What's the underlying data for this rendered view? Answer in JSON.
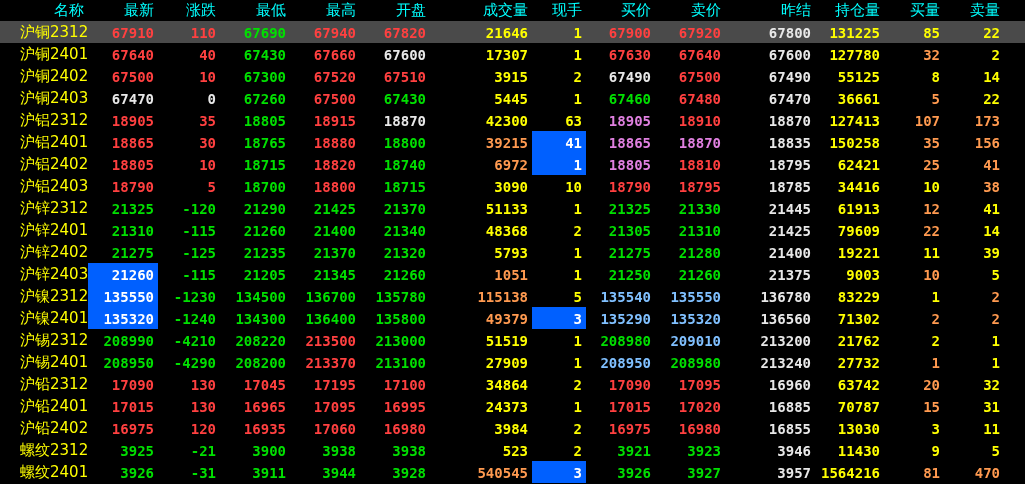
{
  "columns": [
    "名称",
    "最新",
    "涨跌",
    "最低",
    "最高",
    "开盘",
    "成交量",
    "现手",
    "买价",
    "卖价",
    "昨结",
    "持仓量",
    "买量",
    "卖量"
  ],
  "rows": [
    {
      "name": "沪铜2312",
      "selected": true,
      "cells": [
        {
          "text": "67910",
          "color": "#ff4040",
          "highlighted": false
        },
        {
          "text": "110",
          "color": "#ff4040",
          "highlighted": false
        },
        {
          "text": "67690",
          "color": "#00e000",
          "highlighted": false
        },
        {
          "text": "67940",
          "color": "#ff4040",
          "highlighted": false
        },
        {
          "text": "67820",
          "color": "#ff4040",
          "highlighted": false
        },
        {
          "text": "21646",
          "color": "#ffff00",
          "highlighted": false
        },
        {
          "text": "1",
          "color": "#ffff00",
          "highlighted": false
        },
        {
          "text": "67900",
          "color": "#ff4040",
          "highlighted": false
        },
        {
          "text": "67920",
          "color": "#ff4040",
          "highlighted": false
        },
        {
          "text": "67800",
          "color": "#e8e8e8",
          "highlighted": false
        },
        {
          "text": "131225",
          "color": "#ffff00",
          "highlighted": false
        },
        {
          "text": "85",
          "color": "#ffff00",
          "highlighted": false
        },
        {
          "text": "22",
          "color": "#ffff00",
          "highlighted": false
        }
      ]
    },
    {
      "name": "沪铜2401",
      "selected": false,
      "cells": [
        {
          "text": "67640",
          "color": "#ff4040",
          "highlighted": false
        },
        {
          "text": "40",
          "color": "#ff4040",
          "highlighted": false
        },
        {
          "text": "67430",
          "color": "#00e000",
          "highlighted": false
        },
        {
          "text": "67660",
          "color": "#ff4040",
          "highlighted": false
        },
        {
          "text": "67600",
          "color": "#e8e8e8",
          "highlighted": false
        },
        {
          "text": "17307",
          "color": "#ffff00",
          "highlighted": false
        },
        {
          "text": "1",
          "color": "#ffff00",
          "highlighted": false
        },
        {
          "text": "67630",
          "color": "#ff4040",
          "highlighted": false
        },
        {
          "text": "67640",
          "color": "#ff4040",
          "highlighted": false
        },
        {
          "text": "67600",
          "color": "#e8e8e8",
          "highlighted": false
        },
        {
          "text": "127780",
          "color": "#ffff00",
          "highlighted": false
        },
        {
          "text": "32",
          "color": "#ff9a50",
          "highlighted": false
        },
        {
          "text": "2",
          "color": "#ffff00",
          "highlighted": false
        }
      ]
    },
    {
      "name": "沪铜2402",
      "selected": false,
      "cells": [
        {
          "text": "67500",
          "color": "#ff4040",
          "highlighted": false
        },
        {
          "text": "10",
          "color": "#ff4040",
          "highlighted": false
        },
        {
          "text": "67300",
          "color": "#00e000",
          "highlighted": false
        },
        {
          "text": "67520",
          "color": "#ff4040",
          "highlighted": false
        },
        {
          "text": "67510",
          "color": "#ff4040",
          "highlighted": false
        },
        {
          "text": "3915",
          "color": "#ffff00",
          "highlighted": false
        },
        {
          "text": "2",
          "color": "#ffff00",
          "highlighted": false
        },
        {
          "text": "67490",
          "color": "#e8e8e8",
          "highlighted": false
        },
        {
          "text": "67500",
          "color": "#ff4040",
          "highlighted": false
        },
        {
          "text": "67490",
          "color": "#e8e8e8",
          "highlighted": false
        },
        {
          "text": "55125",
          "color": "#ffff00",
          "highlighted": false
        },
        {
          "text": "8",
          "color": "#ffff00",
          "highlighted": false
        },
        {
          "text": "14",
          "color": "#ffff00",
          "highlighted": false
        }
      ]
    },
    {
      "name": "沪铜2403",
      "selected": false,
      "cells": [
        {
          "text": "67470",
          "color": "#e8e8e8",
          "highlighted": false
        },
        {
          "text": "0",
          "color": "#e8e8e8",
          "highlighted": false
        },
        {
          "text": "67260",
          "color": "#00e000",
          "highlighted": false
        },
        {
          "text": "67500",
          "color": "#ff4040",
          "highlighted": false
        },
        {
          "text": "67430",
          "color": "#00e000",
          "highlighted": false
        },
        {
          "text": "5445",
          "color": "#ffff00",
          "highlighted": false
        },
        {
          "text": "1",
          "color": "#ffff00",
          "highlighted": false
        },
        {
          "text": "67460",
          "color": "#00e000",
          "highlighted": false
        },
        {
          "text": "67480",
          "color": "#ff4040",
          "highlighted": false
        },
        {
          "text": "67470",
          "color": "#e8e8e8",
          "highlighted": false
        },
        {
          "text": "36661",
          "color": "#ffff00",
          "highlighted": false
        },
        {
          "text": "5",
          "color": "#ff9a50",
          "highlighted": false
        },
        {
          "text": "22",
          "color": "#ffff00",
          "highlighted": false
        }
      ]
    },
    {
      "name": "沪铝2312",
      "selected": false,
      "cells": [
        {
          "text": "18905",
          "color": "#ff4040",
          "highlighted": false
        },
        {
          "text": "35",
          "color": "#ff4040",
          "highlighted": false
        },
        {
          "text": "18805",
          "color": "#00e000",
          "highlighted": false
        },
        {
          "text": "18915",
          "color": "#ff4040",
          "highlighted": false
        },
        {
          "text": "18870",
          "color": "#e8e8e8",
          "highlighted": false
        },
        {
          "text": "42300",
          "color": "#ffff00",
          "highlighted": false
        },
        {
          "text": "63",
          "color": "#ffff00",
          "highlighted": false
        },
        {
          "text": "18905",
          "color": "#e080e0",
          "highlighted": false
        },
        {
          "text": "18910",
          "color": "#ff4040",
          "highlighted": false
        },
        {
          "text": "18870",
          "color": "#e8e8e8",
          "highlighted": false
        },
        {
          "text": "127413",
          "color": "#ffff00",
          "highlighted": false
        },
        {
          "text": "107",
          "color": "#ff9a50",
          "highlighted": false
        },
        {
          "text": "173",
          "color": "#ff9a50",
          "highlighted": false
        }
      ]
    },
    {
      "name": "沪铝2401",
      "selected": false,
      "cells": [
        {
          "text": "18865",
          "color": "#ff4040",
          "highlighted": false
        },
        {
          "text": "30",
          "color": "#ff4040",
          "highlighted": false
        },
        {
          "text": "18765",
          "color": "#00e000",
          "highlighted": false
        },
        {
          "text": "18880",
          "color": "#ff4040",
          "highlighted": false
        },
        {
          "text": "18800",
          "color": "#00e000",
          "highlighted": false
        },
        {
          "text": "39215",
          "color": "#ff9a50",
          "highlighted": false
        },
        {
          "text": "41",
          "color": "#ffffff",
          "highlighted": true
        },
        {
          "text": "18865",
          "color": "#e080e0",
          "highlighted": false
        },
        {
          "text": "18870",
          "color": "#e080e0",
          "highlighted": false
        },
        {
          "text": "18835",
          "color": "#e8e8e8",
          "highlighted": false
        },
        {
          "text": "150258",
          "color": "#ffff00",
          "highlighted": false
        },
        {
          "text": "35",
          "color": "#ff9a50",
          "highlighted": false
        },
        {
          "text": "156",
          "color": "#ff9a50",
          "highlighted": false
        }
      ]
    },
    {
      "name": "沪铝2402",
      "selected": false,
      "cells": [
        {
          "text": "18805",
          "color": "#ff4040",
          "highlighted": false
        },
        {
          "text": "10",
          "color": "#ff4040",
          "highlighted": false
        },
        {
          "text": "18715",
          "color": "#00e000",
          "highlighted": false
        },
        {
          "text": "18820",
          "color": "#ff4040",
          "highlighted": false
        },
        {
          "text": "18740",
          "color": "#00e000",
          "highlighted": false
        },
        {
          "text": "6972",
          "color": "#ff9a50",
          "highlighted": false
        },
        {
          "text": "1",
          "color": "#ffffff",
          "highlighted": true
        },
        {
          "text": "18805",
          "color": "#e080e0",
          "highlighted": false
        },
        {
          "text": "18810",
          "color": "#ff4040",
          "highlighted": false
        },
        {
          "text": "18795",
          "color": "#e8e8e8",
          "highlighted": false
        },
        {
          "text": "62421",
          "color": "#ffff00",
          "highlighted": false
        },
        {
          "text": "25",
          "color": "#ff9a50",
          "highlighted": false
        },
        {
          "text": "41",
          "color": "#ff9a50",
          "highlighted": false
        }
      ]
    },
    {
      "name": "沪铝2403",
      "selected": false,
      "cells": [
        {
          "text": "18790",
          "color": "#ff4040",
          "highlighted": false
        },
        {
          "text": "5",
          "color": "#ff4040",
          "highlighted": false
        },
        {
          "text": "18700",
          "color": "#00e000",
          "highlighted": false
        },
        {
          "text": "18800",
          "color": "#ff4040",
          "highlighted": false
        },
        {
          "text": "18715",
          "color": "#00e000",
          "highlighted": false
        },
        {
          "text": "3090",
          "color": "#ffff00",
          "highlighted": false
        },
        {
          "text": "10",
          "color": "#ffff00",
          "highlighted": false
        },
        {
          "text": "18790",
          "color": "#ff4040",
          "highlighted": false
        },
        {
          "text": "18795",
          "color": "#ff4040",
          "highlighted": false
        },
        {
          "text": "18785",
          "color": "#e8e8e8",
          "highlighted": false
        },
        {
          "text": "34416",
          "color": "#ffff00",
          "highlighted": false
        },
        {
          "text": "10",
          "color": "#ffff00",
          "highlighted": false
        },
        {
          "text": "38",
          "color": "#ff9a50",
          "highlighted": false
        }
      ]
    },
    {
      "name": "沪锌2312",
      "selected": false,
      "cells": [
        {
          "text": "21325",
          "color": "#00e000",
          "highlighted": false
        },
        {
          "text": "-120",
          "color": "#00e000",
          "highlighted": false
        },
        {
          "text": "21290",
          "color": "#00e000",
          "highlighted": false
        },
        {
          "text": "21425",
          "color": "#00e000",
          "highlighted": false
        },
        {
          "text": "21370",
          "color": "#00e000",
          "highlighted": false
        },
        {
          "text": "51133",
          "color": "#ffff00",
          "highlighted": false
        },
        {
          "text": "1",
          "color": "#ffff00",
          "highlighted": false
        },
        {
          "text": "21325",
          "color": "#00e000",
          "highlighted": false
        },
        {
          "text": "21330",
          "color": "#00e000",
          "highlighted": false
        },
        {
          "text": "21445",
          "color": "#e8e8e8",
          "highlighted": false
        },
        {
          "text": "61913",
          "color": "#ffff00",
          "highlighted": false
        },
        {
          "text": "12",
          "color": "#ff9a50",
          "highlighted": false
        },
        {
          "text": "41",
          "color": "#ffff00",
          "highlighted": false
        }
      ]
    },
    {
      "name": "沪锌2401",
      "selected": false,
      "cells": [
        {
          "text": "21310",
          "color": "#00e000",
          "highlighted": false
        },
        {
          "text": "-115",
          "color": "#00e000",
          "highlighted": false
        },
        {
          "text": "21260",
          "color": "#00e000",
          "highlighted": false
        },
        {
          "text": "21400",
          "color": "#00e000",
          "highlighted": false
        },
        {
          "text": "21340",
          "color": "#00e000",
          "highlighted": false
        },
        {
          "text": "48368",
          "color": "#ffff00",
          "highlighted": false
        },
        {
          "text": "2",
          "color": "#ffff00",
          "highlighted": false
        },
        {
          "text": "21305",
          "color": "#00e000",
          "highlighted": false
        },
        {
          "text": "21310",
          "color": "#00e000",
          "highlighted": false
        },
        {
          "text": "21425",
          "color": "#e8e8e8",
          "highlighted": false
        },
        {
          "text": "79609",
          "color": "#ffff00",
          "highlighted": false
        },
        {
          "text": "22",
          "color": "#ff9a50",
          "highlighted": false
        },
        {
          "text": "14",
          "color": "#ffff00",
          "highlighted": false
        }
      ]
    },
    {
      "name": "沪锌2402",
      "selected": false,
      "cells": [
        {
          "text": "21275",
          "color": "#00e000",
          "highlighted": false
        },
        {
          "text": "-125",
          "color": "#00e000",
          "highlighted": false
        },
        {
          "text": "21235",
          "color": "#00e000",
          "highlighted": false
        },
        {
          "text": "21370",
          "color": "#00e000",
          "highlighted": false
        },
        {
          "text": "21320",
          "color": "#00e000",
          "highlighted": false
        },
        {
          "text": "5793",
          "color": "#ffff00",
          "highlighted": false
        },
        {
          "text": "1",
          "color": "#ffff00",
          "highlighted": false
        },
        {
          "text": "21275",
          "color": "#00e000",
          "highlighted": false
        },
        {
          "text": "21280",
          "color": "#00e000",
          "highlighted": false
        },
        {
          "text": "21400",
          "color": "#e8e8e8",
          "highlighted": false
        },
        {
          "text": "19221",
          "color": "#ffff00",
          "highlighted": false
        },
        {
          "text": "11",
          "color": "#ffff00",
          "highlighted": false
        },
        {
          "text": "39",
          "color": "#ffff00",
          "highlighted": false
        }
      ]
    },
    {
      "name": "沪锌2403",
      "selected": false,
      "cells": [
        {
          "text": "21260",
          "color": "#ffffff",
          "highlighted": true
        },
        {
          "text": "-115",
          "color": "#00e000",
          "highlighted": false
        },
        {
          "text": "21205",
          "color": "#00e000",
          "highlighted": false
        },
        {
          "text": "21345",
          "color": "#00e000",
          "highlighted": false
        },
        {
          "text": "21260",
          "color": "#00e000",
          "highlighted": false
        },
        {
          "text": "1051",
          "color": "#ff9a50",
          "highlighted": false
        },
        {
          "text": "1",
          "color": "#ffff00",
          "highlighted": false
        },
        {
          "text": "21250",
          "color": "#00e000",
          "highlighted": false
        },
        {
          "text": "21260",
          "color": "#00e000",
          "highlighted": false
        },
        {
          "text": "21375",
          "color": "#e8e8e8",
          "highlighted": false
        },
        {
          "text": "9003",
          "color": "#ffff00",
          "highlighted": false
        },
        {
          "text": "10",
          "color": "#ff9a50",
          "highlighted": false
        },
        {
          "text": "5",
          "color": "#ffff00",
          "highlighted": false
        }
      ]
    },
    {
      "name": "沪镍2312",
      "selected": false,
      "cells": [
        {
          "text": "135550",
          "color": "#ffffff",
          "highlighted": true
        },
        {
          "text": "-1230",
          "color": "#00e000",
          "highlighted": false
        },
        {
          "text": "134500",
          "color": "#00e000",
          "highlighted": false
        },
        {
          "text": "136700",
          "color": "#00e000",
          "highlighted": false
        },
        {
          "text": "135780",
          "color": "#00e000",
          "highlighted": false
        },
        {
          "text": "115138",
          "color": "#ff9a50",
          "highlighted": false
        },
        {
          "text": "5",
          "color": "#ffff00",
          "highlighted": false
        },
        {
          "text": "135540",
          "color": "#80c0ff",
          "highlighted": false
        },
        {
          "text": "135550",
          "color": "#80c0ff",
          "highlighted": false
        },
        {
          "text": "136780",
          "color": "#e8e8e8",
          "highlighted": false
        },
        {
          "text": "83229",
          "color": "#ffff00",
          "highlighted": false
        },
        {
          "text": "1",
          "color": "#ffff00",
          "highlighted": false
        },
        {
          "text": "2",
          "color": "#ff9a50",
          "highlighted": false
        }
      ]
    },
    {
      "name": "沪镍2401",
      "selected": false,
      "cells": [
        {
          "text": "135320",
          "color": "#ffffff",
          "highlighted": true
        },
        {
          "text": "-1240",
          "color": "#00e000",
          "highlighted": false
        },
        {
          "text": "134300",
          "color": "#00e000",
          "highlighted": false
        },
        {
          "text": "136400",
          "color": "#00e000",
          "highlighted": false
        },
        {
          "text": "135800",
          "color": "#00e000",
          "highlighted": false
        },
        {
          "text": "49379",
          "color": "#ff9a50",
          "highlighted": false
        },
        {
          "text": "3",
          "color": "#ffffff",
          "highlighted": true
        },
        {
          "text": "135290",
          "color": "#80c0ff",
          "highlighted": false
        },
        {
          "text": "135320",
          "color": "#80c0ff",
          "highlighted": false
        },
        {
          "text": "136560",
          "color": "#e8e8e8",
          "highlighted": false
        },
        {
          "text": "71302",
          "color": "#ffff00",
          "highlighted": false
        },
        {
          "text": "2",
          "color": "#ff9a50",
          "highlighted": false
        },
        {
          "text": "2",
          "color": "#ff9a50",
          "highlighted": false
        }
      ]
    },
    {
      "name": "沪锡2312",
      "selected": false,
      "cells": [
        {
          "text": "208990",
          "color": "#00e000",
          "highlighted": false
        },
        {
          "text": "-4210",
          "color": "#00e000",
          "highlighted": false
        },
        {
          "text": "208220",
          "color": "#00e000",
          "highlighted": false
        },
        {
          "text": "213500",
          "color": "#ff4040",
          "highlighted": false
        },
        {
          "text": "213000",
          "color": "#00e000",
          "highlighted": false
        },
        {
          "text": "51519",
          "color": "#ffff00",
          "highlighted": false
        },
        {
          "text": "1",
          "color": "#ffff00",
          "highlighted": false
        },
        {
          "text": "208980",
          "color": "#00e000",
          "highlighted": false
        },
        {
          "text": "209010",
          "color": "#80c0ff",
          "highlighted": false
        },
        {
          "text": "213200",
          "color": "#e8e8e8",
          "highlighted": false
        },
        {
          "text": "21762",
          "color": "#ffff00",
          "highlighted": false
        },
        {
          "text": "2",
          "color": "#ffff00",
          "highlighted": false
        },
        {
          "text": "1",
          "color": "#ffff00",
          "highlighted": false
        }
      ]
    },
    {
      "name": "沪锡2401",
      "selected": false,
      "cells": [
        {
          "text": "208950",
          "color": "#00e000",
          "highlighted": false
        },
        {
          "text": "-4290",
          "color": "#00e000",
          "highlighted": false
        },
        {
          "text": "208200",
          "color": "#00e000",
          "highlighted": false
        },
        {
          "text": "213370",
          "color": "#ff4040",
          "highlighted": false
        },
        {
          "text": "213100",
          "color": "#00e000",
          "highlighted": false
        },
        {
          "text": "27909",
          "color": "#ffff00",
          "highlighted": false
        },
        {
          "text": "1",
          "color": "#ffff00",
          "highlighted": false
        },
        {
          "text": "208950",
          "color": "#80c0ff",
          "highlighted": false
        },
        {
          "text": "208980",
          "color": "#00e000",
          "highlighted": false
        },
        {
          "text": "213240",
          "color": "#e8e8e8",
          "highlighted": false
        },
        {
          "text": "27732",
          "color": "#ffff00",
          "highlighted": false
        },
        {
          "text": "1",
          "color": "#ff9a50",
          "highlighted": false
        },
        {
          "text": "1",
          "color": "#ffff00",
          "highlighted": false
        }
      ]
    },
    {
      "name": "沪铅2312",
      "selected": false,
      "cells": [
        {
          "text": "17090",
          "color": "#ff4040",
          "highlighted": false
        },
        {
          "text": "130",
          "color": "#ff4040",
          "highlighted": false
        },
        {
          "text": "17045",
          "color": "#ff4040",
          "highlighted": false
        },
        {
          "text": "17195",
          "color": "#ff4040",
          "highlighted": false
        },
        {
          "text": "17100",
          "color": "#ff4040",
          "highlighted": false
        },
        {
          "text": "34864",
          "color": "#ffff00",
          "highlighted": false
        },
        {
          "text": "2",
          "color": "#ffff00",
          "highlighted": false
        },
        {
          "text": "17090",
          "color": "#ff4040",
          "highlighted": false
        },
        {
          "text": "17095",
          "color": "#ff4040",
          "highlighted": false
        },
        {
          "text": "16960",
          "color": "#e8e8e8",
          "highlighted": false
        },
        {
          "text": "63742",
          "color": "#ffff00",
          "highlighted": false
        },
        {
          "text": "20",
          "color": "#ff9a50",
          "highlighted": false
        },
        {
          "text": "32",
          "color": "#ffff00",
          "highlighted": false
        }
      ]
    },
    {
      "name": "沪铅2401",
      "selected": false,
      "cells": [
        {
          "text": "17015",
          "color": "#ff4040",
          "highlighted": false
        },
        {
          "text": "130",
          "color": "#ff4040",
          "highlighted": false
        },
        {
          "text": "16965",
          "color": "#ff4040",
          "highlighted": false
        },
        {
          "text": "17095",
          "color": "#ff4040",
          "highlighted": false
        },
        {
          "text": "16995",
          "color": "#ff4040",
          "highlighted": false
        },
        {
          "text": "24373",
          "color": "#ffff00",
          "highlighted": false
        },
        {
          "text": "1",
          "color": "#ffff00",
          "highlighted": false
        },
        {
          "text": "17015",
          "color": "#ff4040",
          "highlighted": false
        },
        {
          "text": "17020",
          "color": "#ff4040",
          "highlighted": false
        },
        {
          "text": "16885",
          "color": "#e8e8e8",
          "highlighted": false
        },
        {
          "text": "70787",
          "color": "#ffff00",
          "highlighted": false
        },
        {
          "text": "15",
          "color": "#ff9a50",
          "highlighted": false
        },
        {
          "text": "31",
          "color": "#ffff00",
          "highlighted": false
        }
      ]
    },
    {
      "name": "沪铅2402",
      "selected": false,
      "cells": [
        {
          "text": "16975",
          "color": "#ff4040",
          "highlighted": false
        },
        {
          "text": "120",
          "color": "#ff4040",
          "highlighted": false
        },
        {
          "text": "16935",
          "color": "#ff4040",
          "highlighted": false
        },
        {
          "text": "17060",
          "color": "#ff4040",
          "highlighted": false
        },
        {
          "text": "16980",
          "color": "#ff4040",
          "highlighted": false
        },
        {
          "text": "3984",
          "color": "#ffff00",
          "highlighted": false
        },
        {
          "text": "2",
          "color": "#ffff00",
          "highlighted": false
        },
        {
          "text": "16975",
          "color": "#ff4040",
          "highlighted": false
        },
        {
          "text": "16980",
          "color": "#ff4040",
          "highlighted": false
        },
        {
          "text": "16855",
          "color": "#e8e8e8",
          "highlighted": false
        },
        {
          "text": "13030",
          "color": "#ffff00",
          "highlighted": false
        },
        {
          "text": "3",
          "color": "#ffff00",
          "highlighted": false
        },
        {
          "text": "11",
          "color": "#ffff00",
          "highlighted": false
        }
      ]
    },
    {
      "name": "螺纹2312",
      "selected": false,
      "cells": [
        {
          "text": "3925",
          "color": "#00e000",
          "highlighted": false
        },
        {
          "text": "-21",
          "color": "#00e000",
          "highlighted": false
        },
        {
          "text": "3900",
          "color": "#00e000",
          "highlighted": false
        },
        {
          "text": "3938",
          "color": "#00e000",
          "highlighted": false
        },
        {
          "text": "3938",
          "color": "#00e000",
          "highlighted": false
        },
        {
          "text": "523",
          "color": "#ffff00",
          "highlighted": false
        },
        {
          "text": "2",
          "color": "#ffff00",
          "highlighted": false
        },
        {
          "text": "3921",
          "color": "#00e000",
          "highlighted": false
        },
        {
          "text": "3923",
          "color": "#00e000",
          "highlighted": false
        },
        {
          "text": "3946",
          "color": "#e8e8e8",
          "highlighted": false
        },
        {
          "text": "11430",
          "color": "#ffff00",
          "highlighted": false
        },
        {
          "text": "9",
          "color": "#ffff00",
          "highlighted": false
        },
        {
          "text": "5",
          "color": "#ffff00",
          "highlighted": false
        }
      ]
    },
    {
      "name": "螺纹2401",
      "selected": false,
      "cells": [
        {
          "text": "3926",
          "color": "#00e000",
          "highlighted": false
        },
        {
          "text": "-31",
          "color": "#00e000",
          "highlighted": false
        },
        {
          "text": "3911",
          "color": "#00e000",
          "highlighted": false
        },
        {
          "text": "3944",
          "color": "#00e000",
          "highlighted": false
        },
        {
          "text": "3928",
          "color": "#00e000",
          "highlighted": false
        },
        {
          "text": "540545",
          "color": "#ff9a50",
          "highlighted": false
        },
        {
          "text": "3",
          "color": "#ffffff",
          "highlighted": true
        },
        {
          "text": "3926",
          "color": "#00e000",
          "highlighted": false
        },
        {
          "text": "3927",
          "color": "#00e000",
          "highlighted": false
        },
        {
          "text": "3957",
          "color": "#e8e8e8",
          "highlighted": false
        },
        {
          "text": "1564216",
          "color": "#ffff00",
          "highlighted": false
        },
        {
          "text": "81",
          "color": "#ff9a50",
          "highlighted": false
        },
        {
          "text": "470",
          "color": "#ff9a50",
          "highlighted": false
        }
      ]
    }
  ]
}
